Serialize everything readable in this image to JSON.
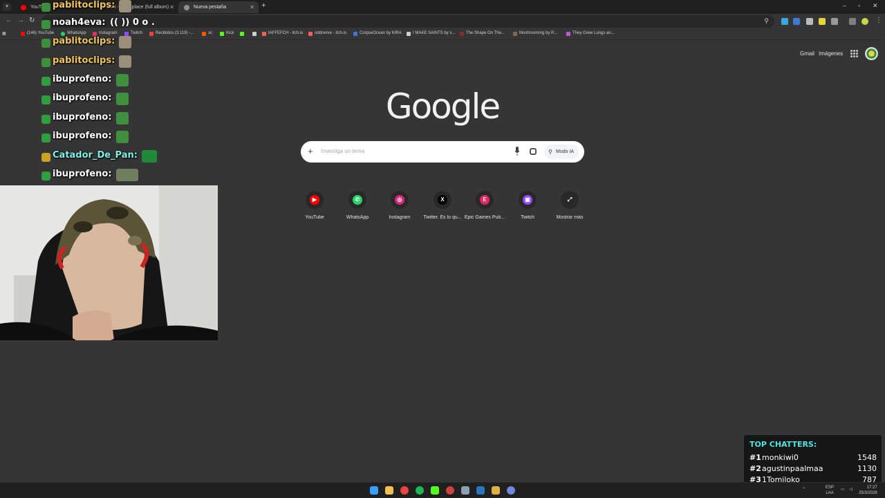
{
  "tabs": [
    {
      "title": "YouTube",
      "color": "#ff0000",
      "active": false
    },
    {
      "title": "zohi - #fuckplace (full album)",
      "color": "#ff0000",
      "active": false
    },
    {
      "title": "Nueva pestaña",
      "color": "#8e8e8e",
      "active": true
    }
  ],
  "bookmarks": [
    {
      "label": "(146) YouTube",
      "color": "#ff0000"
    },
    {
      "label": "WhatsApp",
      "color": "#25d366"
    },
    {
      "label": "Instagram",
      "color": "#e1306c"
    },
    {
      "label": "Twitch",
      "color": "#9146ff"
    },
    {
      "label": "Recibidos (3.119) -...",
      "color": "#ea4335"
    },
    {
      "label": "sc",
      "color": "#ff5500"
    },
    {
      "label": "Kick",
      "color": "#53fc18"
    },
    {
      "label": "",
      "color": "#53fc18"
    },
    {
      "label": "",
      "color": "#cfcfcf"
    },
    {
      "label": "IAFFEFCH - itch.io",
      "color": "#fa5c5c"
    },
    {
      "label": "oddnerve - itch.io",
      "color": "#fa5c5c"
    },
    {
      "label": "CorpseOcean by KIRA",
      "color": "#3a7bd5"
    },
    {
      "label": "I MAKE SAINTS by s...",
      "color": "#cfcfcf"
    },
    {
      "label": "The Shape On The...",
      "color": "#8a2a2a"
    },
    {
      "label": "Mushrooming by R...",
      "color": "#7a6a5a"
    },
    {
      "label": "They Grew Lungs an...",
      "color": "#c05ad0"
    }
  ],
  "ntp": {
    "gmail": "Gmail",
    "images": "Imágenes",
    "logo": "Google",
    "search_placeholder": "Investiga un tema",
    "ai_mode": "Modo IA",
    "shortcuts": [
      {
        "label": "YouTube",
        "icon": "youtube-icon",
        "color": "#ff0000",
        "glyph": "▶"
      },
      {
        "label": "WhatsApp",
        "icon": "whatsapp-icon",
        "color": "#25d366",
        "glyph": "✆"
      },
      {
        "label": "Instagram",
        "icon": "instagram-icon",
        "color": "#d62976",
        "glyph": "◎"
      },
      {
        "label": "Twitter. Es lo qu...",
        "icon": "x-icon",
        "color": "#000000",
        "glyph": "X"
      },
      {
        "label": "Epic Games Pub...",
        "icon": "epic-games-icon",
        "color": "#e0245e",
        "glyph": "E"
      },
      {
        "label": "Twitch",
        "icon": "twitch-icon",
        "color": "#9146ff",
        "glyph": "▣"
      },
      {
        "label": "Mostrar más",
        "icon": "expand-icon",
        "color": "#282828",
        "glyph": "⤢"
      }
    ]
  },
  "chat": [
    {
      "name": "pablitoclips:",
      "message": "",
      "name_color": "#f3c65a",
      "badge_color": "#3d8f3d",
      "emote_color": "#9c8f7a"
    },
    {
      "name": "noah4eva:",
      "message": "(( )) 0 o .",
      "name_color": "#ffffff",
      "badge_color": "#3d8f3d",
      "emote_color": "#5b7fb0"
    },
    {
      "name": "pablitoclips:",
      "message": "",
      "name_color": "#f3c65a",
      "badge_color": "#3d8f3d",
      "emote_color": "#9c8f7a"
    },
    {
      "name": "pablitoclips:",
      "message": "",
      "name_color": "#f3c65a",
      "badge_color": "#3d8f3d",
      "emote_color": "#9c8f7a"
    },
    {
      "name": "ibuprofeno:",
      "message": "",
      "name_color": "#ffffff",
      "badge_color": "#2e9e3e",
      "emote_color": "#3f8f3f"
    },
    {
      "name": "ibuprofeno:",
      "message": "",
      "name_color": "#ffffff",
      "badge_color": "#2e9e3e",
      "emote_color": "#3f8f3f"
    },
    {
      "name": "ibuprofeno:",
      "message": "",
      "name_color": "#ffffff",
      "badge_color": "#2e9e3e",
      "emote_color": "#3f8f3f"
    },
    {
      "name": "ibuprofeno:",
      "message": "",
      "name_color": "#ffffff",
      "badge_color": "#2e9e3e",
      "emote_color": "#3f8f3f"
    },
    {
      "name": "Catador_De_Pan:",
      "message": "",
      "name_color": "#7ff0e6",
      "badge_color": "#c9a227",
      "emote_color": "#1f8a3a"
    },
    {
      "name": "ibuprofeno:",
      "message": "",
      "name_color": "#ffffff",
      "badge_color": "#2e9e3e",
      "emote_color": "#6f7f5f"
    }
  ],
  "top_chatters": {
    "title": "TOP CHATTERS:",
    "rows": [
      {
        "rank": "#1",
        "name": "monkiwi0",
        "score": "1548"
      },
      {
        "rank": "#2",
        "name": "agustinpaalmaa",
        "score": "1130"
      },
      {
        "rank": "#3",
        "name": "1Tomiloko",
        "score": "787"
      }
    ]
  },
  "taskbar": {
    "icons": [
      {
        "name": "windows-start-icon",
        "color": "#3aa0ff"
      },
      {
        "name": "file-explorer-icon",
        "color": "#f2c14e"
      },
      {
        "name": "chrome-icon",
        "color": "#e8453c"
      },
      {
        "name": "spotify-icon",
        "color": "#1db954"
      },
      {
        "name": "kick-icon",
        "color": "#53fc18"
      },
      {
        "name": "obs-icon",
        "color": "#d04040"
      },
      {
        "name": "app-icon",
        "color": "#8aa0b0"
      },
      {
        "name": "steam-icon",
        "color": "#2a75bb"
      },
      {
        "name": "notepad-icon",
        "color": "#e0b040"
      },
      {
        "name": "discord-icon",
        "color": "#7289da"
      }
    ],
    "lang_top": "ESP",
    "lang_bottom": "LAA",
    "time": "17:27",
    "date": "25/3/2026"
  }
}
